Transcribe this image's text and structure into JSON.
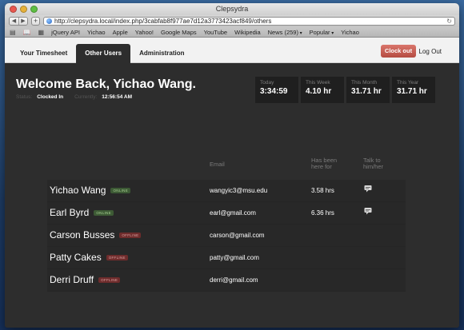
{
  "window": {
    "title": "Clepsydra"
  },
  "toolbar": {
    "url": "http://clepsydra.local/index.php/3cabfab8f977ae7d12a3773423acf849/others"
  },
  "bookmarks": [
    {
      "label": "jQuery API"
    },
    {
      "label": "Yichao"
    },
    {
      "label": "Apple"
    },
    {
      "label": "Yahoo!"
    },
    {
      "label": "Google Maps"
    },
    {
      "label": "YouTube"
    },
    {
      "label": "Wikipedia"
    },
    {
      "label": "News (259)"
    },
    {
      "label": "Popular"
    },
    {
      "label": "Yichao"
    }
  ],
  "nav": {
    "tabs": [
      {
        "label": "Your Timesheet"
      },
      {
        "label": "Other Users"
      },
      {
        "label": "Administration"
      }
    ],
    "clockout_label": "Clock out",
    "logout_label": "Log Out"
  },
  "header": {
    "welcome": "Welcome Back, Yichao Wang.",
    "status_label": "Status:",
    "status_value": "Clocked In",
    "currently_label": "Currently:",
    "currently_value": "12:56:54 AM"
  },
  "stats": [
    {
      "label": "Today",
      "value": "3:34:59"
    },
    {
      "label": "This Week",
      "value": "4.10 hr"
    },
    {
      "label": "This Month",
      "value": "31.71 hr"
    },
    {
      "label": "This Year",
      "value": "31.71 hr"
    }
  ],
  "table": {
    "headers": {
      "email": "Email",
      "here": "Has been here for",
      "talk": "Talk to him/her"
    },
    "rows": [
      {
        "name": "Yichao Wang",
        "status": "online",
        "email": "wangyic3@msu.edu",
        "hours": "3.58 hrs"
      },
      {
        "name": "Earl Byrd",
        "status": "online",
        "email": "earl@gmail.com",
        "hours": "6.36 hrs"
      },
      {
        "name": "Carson Busses",
        "status": "offline",
        "email": "carson@gmail.com",
        "hours": ""
      },
      {
        "name": "Patty Cakes",
        "status": "offline",
        "email": "patty@gmail.com",
        "hours": ""
      },
      {
        "name": "Derri Druff",
        "status": "offline",
        "email": "derri@gmail.com",
        "hours": ""
      }
    ]
  },
  "colors": {
    "online": "#3d5a35",
    "offline": "#6e2c2c",
    "clockout": "#c25a50"
  }
}
